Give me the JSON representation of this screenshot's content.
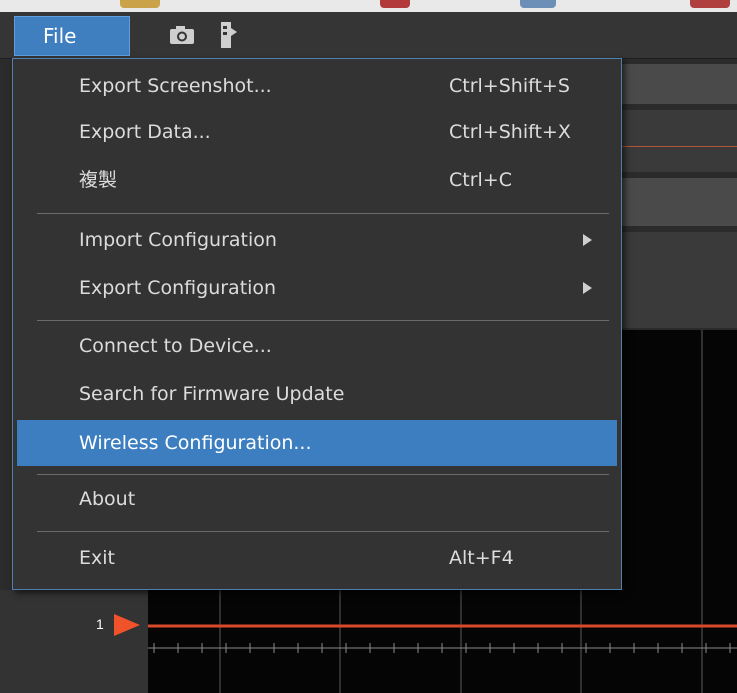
{
  "menubar": {
    "file_label": "File",
    "icons": [
      "camera-icon",
      "device-icon"
    ]
  },
  "file_menu": {
    "items": [
      {
        "label": "Export Screenshot...",
        "shortcut": "Ctrl+Shift+S"
      },
      {
        "label": "Export Data...",
        "shortcut": "Ctrl+Shift+X"
      },
      {
        "label": "複製",
        "shortcut": "Ctrl+C"
      },
      {
        "label": "Import Configuration",
        "submenu": true
      },
      {
        "label": "Export Configuration",
        "submenu": true
      },
      {
        "label": "Connect to Device..."
      },
      {
        "label": "Search for Firmware Update"
      },
      {
        "label": "Wireless Configuration...",
        "highlighted": true
      },
      {
        "label": "About"
      },
      {
        "label": "Exit",
        "shortcut": "Alt+F4"
      }
    ]
  },
  "scope": {
    "channel_label": "1",
    "trace_color": "#d9492c",
    "marker_color": "#f0522a"
  },
  "colors": {
    "accent": "#3d7ec0",
    "menu_bg": "#333333",
    "scope_bg": "#050505"
  }
}
